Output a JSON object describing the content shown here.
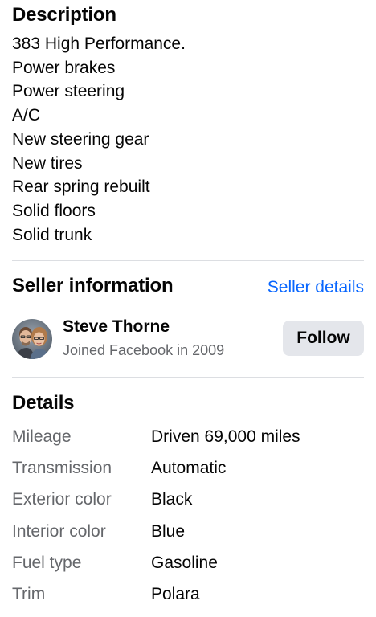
{
  "description": {
    "title": "Description",
    "lines": [
      "383 High Performance.",
      "Power brakes",
      "Power steering",
      "A/C",
      "New steering gear",
      "New tires",
      "Rear spring rebuilt",
      "Solid floors",
      "Solid trunk"
    ]
  },
  "seller": {
    "title": "Seller information",
    "details_link": "Seller details",
    "name": "Steve Thorne",
    "joined": "Joined Facebook in 2009",
    "follow_label": "Follow"
  },
  "details": {
    "title": "Details",
    "rows": [
      {
        "label": "Mileage",
        "value": "Driven 69,000 miles"
      },
      {
        "label": "Transmission",
        "value": "Automatic"
      },
      {
        "label": "Exterior color",
        "value": "Black"
      },
      {
        "label": "Interior color",
        "value": "Blue"
      },
      {
        "label": "Fuel type",
        "value": "Gasoline"
      },
      {
        "label": "Trim",
        "value": "Polara"
      }
    ]
  },
  "colors": {
    "link": "#0866ff",
    "secondary_text": "#65676b",
    "button_bg": "#e4e6eb",
    "divider": "#dcdee2"
  }
}
